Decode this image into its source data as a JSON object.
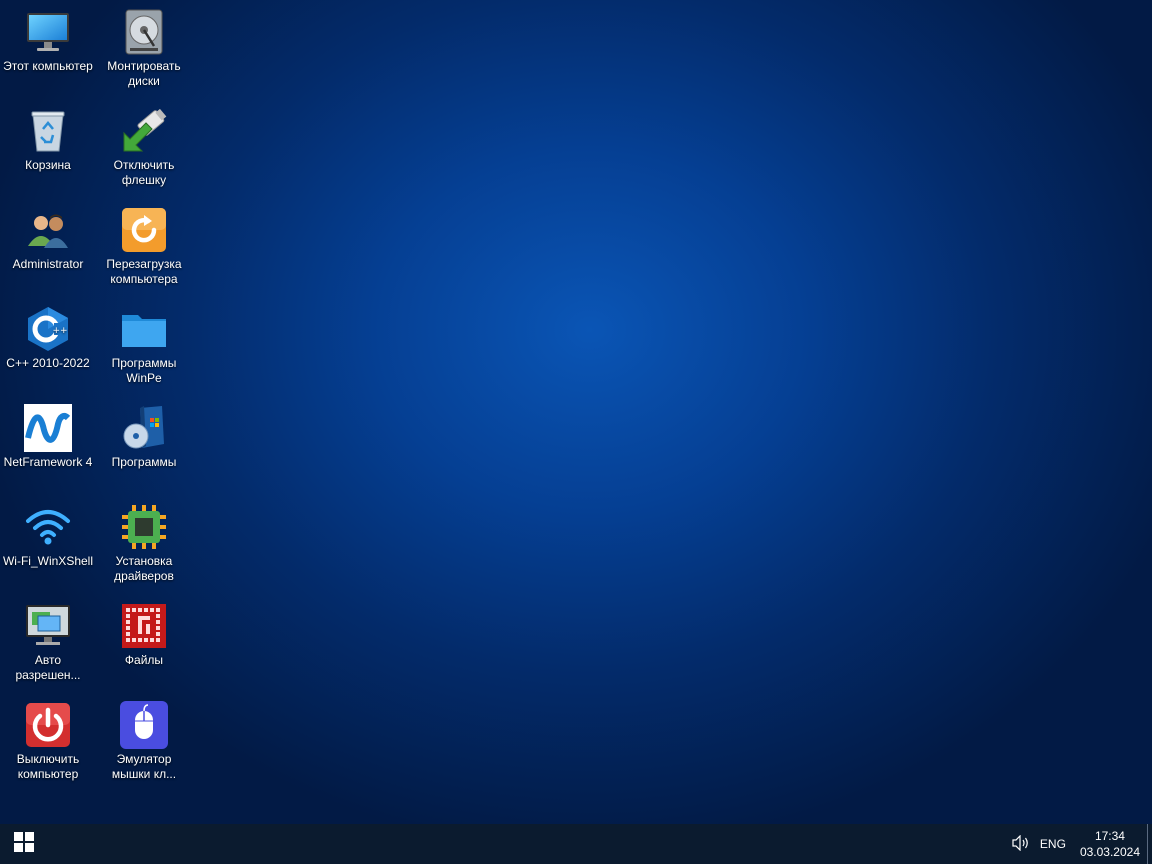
{
  "desktop": {
    "icons": [
      {
        "label": "Этот компьютер",
        "icon": "monitor-icon"
      },
      {
        "label": "Монтировать\nдиски",
        "icon": "hard-drive-icon"
      },
      {
        "label": "Корзина",
        "icon": "recycle-bin-icon"
      },
      {
        "label": "Отключить\nфлешку",
        "icon": "usb-eject-icon"
      },
      {
        "label": "Administrator",
        "icon": "users-icon"
      },
      {
        "label": "Перезагрузка\nкомпьютера",
        "icon": "restart-icon"
      },
      {
        "label": "C++ 2010-2022",
        "icon": "cpp-icon"
      },
      {
        "label": "Программы\nWinPe",
        "icon": "folder-icon"
      },
      {
        "label": "NetFramework 4",
        "icon": "net-framework-icon"
      },
      {
        "label": "Программы",
        "icon": "programs-box-icon"
      },
      {
        "label": "Wi-Fi_WinXShell",
        "icon": "wifi-icon"
      },
      {
        "label": "Установка\nдрайверов",
        "icon": "chip-icon"
      },
      {
        "label": "Авто\nразрешен...",
        "icon": "display-settings-icon"
      },
      {
        "label": "Файлы",
        "icon": "file-manager-icon"
      },
      {
        "label": "Выключить\nкомпьютер",
        "icon": "power-icon"
      },
      {
        "label": "Эмулятор\nмышки кл...",
        "icon": "mouse-icon"
      }
    ]
  },
  "taskbar": {
    "start_icon": "windows-logo-icon",
    "volume_icon": "speaker-icon",
    "language": "ENG",
    "time": "17:34",
    "date": "03.03.2024",
    "background": "#0b1b2f"
  }
}
